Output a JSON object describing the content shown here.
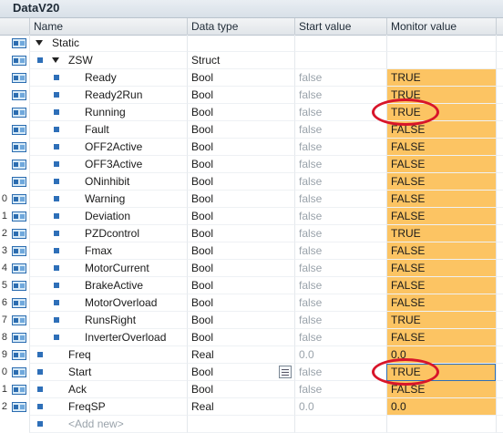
{
  "title": "DataV20",
  "columns": {
    "name": "Name",
    "datatype": "Data type",
    "start": "Start value",
    "monitor": "Monitor value"
  },
  "rows": [
    {
      "num": "",
      "level": 0,
      "expand": "down",
      "name": "Static",
      "type": "",
      "start": "",
      "monitor": "",
      "icon": "db-icon",
      "bullet": false
    },
    {
      "num": "",
      "level": 1,
      "expand": "down",
      "name": "ZSW",
      "type": "Struct",
      "start": "",
      "monitor": "",
      "icon": "db-icon",
      "bullet": true
    },
    {
      "num": "",
      "level": 2,
      "expand": "",
      "name": "Ready",
      "type": "Bool",
      "start": "false",
      "monitor": "TRUE",
      "icon": "db-icon",
      "bullet": true
    },
    {
      "num": "",
      "level": 2,
      "expand": "",
      "name": "Ready2Run",
      "type": "Bool",
      "start": "false",
      "monitor": "TRUE",
      "icon": "db-icon",
      "bullet": true
    },
    {
      "num": "",
      "level": 2,
      "expand": "",
      "name": "Running",
      "type": "Bool",
      "start": "false",
      "monitor": "TRUE",
      "icon": "db-icon",
      "bullet": true
    },
    {
      "num": "",
      "level": 2,
      "expand": "",
      "name": "Fault",
      "type": "Bool",
      "start": "false",
      "monitor": "FALSE",
      "icon": "db-icon",
      "bullet": true
    },
    {
      "num": "",
      "level": 2,
      "expand": "",
      "name": "OFF2Active",
      "type": "Bool",
      "start": "false",
      "monitor": "FALSE",
      "icon": "db-icon",
      "bullet": true
    },
    {
      "num": "",
      "level": 2,
      "expand": "",
      "name": "OFF3Active",
      "type": "Bool",
      "start": "false",
      "monitor": "FALSE",
      "icon": "db-icon",
      "bullet": true
    },
    {
      "num": "",
      "level": 2,
      "expand": "",
      "name": "ONinhibit",
      "type": "Bool",
      "start": "false",
      "monitor": "FALSE",
      "icon": "db-icon",
      "bullet": true
    },
    {
      "num": "0",
      "level": 2,
      "expand": "",
      "name": "Warning",
      "type": "Bool",
      "start": "false",
      "monitor": "FALSE",
      "icon": "db-icon",
      "bullet": true
    },
    {
      "num": "1",
      "level": 2,
      "expand": "",
      "name": "Deviation",
      "type": "Bool",
      "start": "false",
      "monitor": "FALSE",
      "icon": "db-icon",
      "bullet": true
    },
    {
      "num": "2",
      "level": 2,
      "expand": "",
      "name": "PZDcontrol",
      "type": "Bool",
      "start": "false",
      "monitor": "TRUE",
      "icon": "db-icon",
      "bullet": true
    },
    {
      "num": "3",
      "level": 2,
      "expand": "",
      "name": "Fmax",
      "type": "Bool",
      "start": "false",
      "monitor": "FALSE",
      "icon": "db-icon",
      "bullet": true
    },
    {
      "num": "4",
      "level": 2,
      "expand": "",
      "name": "MotorCurrent",
      "type": "Bool",
      "start": "false",
      "monitor": "FALSE",
      "icon": "db-icon",
      "bullet": true
    },
    {
      "num": "5",
      "level": 2,
      "expand": "",
      "name": "BrakeActive",
      "type": "Bool",
      "start": "false",
      "monitor": "FALSE",
      "icon": "db-icon",
      "bullet": true
    },
    {
      "num": "6",
      "level": 2,
      "expand": "",
      "name": "MotorOverload",
      "type": "Bool",
      "start": "false",
      "monitor": "FALSE",
      "icon": "db-icon",
      "bullet": true
    },
    {
      "num": "7",
      "level": 2,
      "expand": "",
      "name": "RunsRight",
      "type": "Bool",
      "start": "false",
      "monitor": "TRUE",
      "icon": "db-icon",
      "bullet": true
    },
    {
      "num": "8",
      "level": 2,
      "expand": "",
      "name": "InverterOverload",
      "type": "Bool",
      "start": "false",
      "monitor": "FALSE",
      "icon": "db-icon",
      "bullet": true
    },
    {
      "num": "9",
      "level": 1,
      "expand": "",
      "name": "Freq",
      "type": "Real",
      "start": "0.0",
      "monitor": "0.0",
      "icon": "db-icon",
      "bullet": true
    },
    {
      "num": "0",
      "level": 1,
      "expand": "",
      "name": "Start",
      "type": "Bool",
      "start": "false",
      "monitor": "TRUE",
      "icon": "db-icon",
      "bullet": true
    },
    {
      "num": "1",
      "level": 1,
      "expand": "",
      "name": "Ack",
      "type": "Bool",
      "start": "false",
      "monitor": "FALSE",
      "icon": "db-icon",
      "bullet": true
    },
    {
      "num": "2",
      "level": 1,
      "expand": "",
      "name": "FreqSP",
      "type": "Real",
      "start": "0.0",
      "monitor": "0.0",
      "icon": "db-icon",
      "bullet": true
    },
    {
      "num": "",
      "level": 1,
      "expand": "",
      "name": "<Add new>",
      "type": "",
      "start": "",
      "monitor": "",
      "icon": "",
      "bullet": true,
      "placeholder": true
    }
  ],
  "colors": {
    "monitor_bg": "#fcc463",
    "highlight": "#d8152a",
    "bullet": "#2e6fb8"
  }
}
